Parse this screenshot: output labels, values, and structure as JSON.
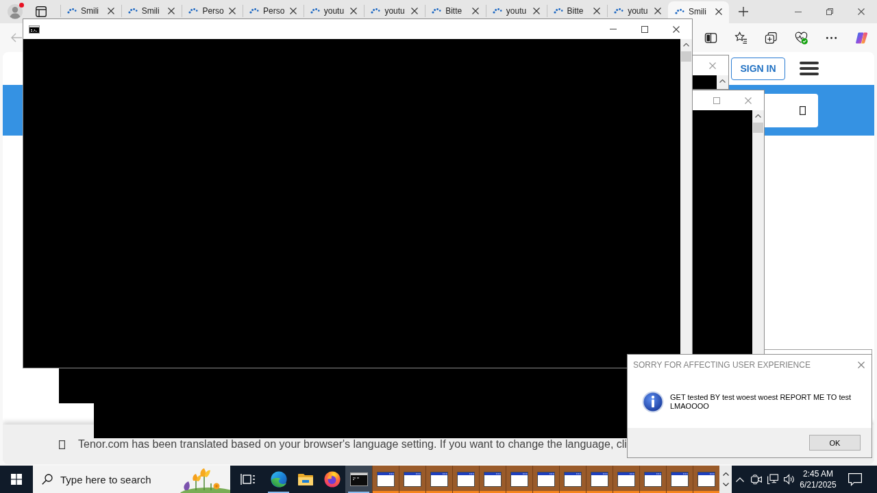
{
  "browser": {
    "profile": {
      "notification": true
    },
    "tabs": [
      {
        "label": "Smili",
        "selected": false
      },
      {
        "label": "Smili",
        "selected": false
      },
      {
        "label": "Perso",
        "selected": false
      },
      {
        "label": "Perso",
        "selected": false
      },
      {
        "label": "youtu",
        "selected": false
      },
      {
        "label": "youtu",
        "selected": false
      },
      {
        "label": "Bitte",
        "selected": false
      },
      {
        "label": "youtu",
        "selected": false
      },
      {
        "label": "Bitte",
        "selected": false
      },
      {
        "label": "youtu",
        "selected": false
      },
      {
        "label": "Smili",
        "selected": true
      }
    ],
    "page": {
      "sign_in": "SIGN IN",
      "translation_notice": "Tenor.com has been translated based on your browser's language setting. If you want to change the language, cli"
    }
  },
  "dialog": {
    "title": "SORRY FOR AFFECTING USER EXPERIENCE",
    "message": "GET tested BY test woest woest REPORT ME TO test LMAOOOO",
    "button": "OK"
  },
  "taskbar": {
    "search": {
      "placeholder": "Type here to search"
    },
    "buttons": [
      {
        "kind": "task-view",
        "selected": false,
        "running": false,
        "flashing": false
      },
      {
        "kind": "edge",
        "selected": false,
        "running": true,
        "flashing": false
      },
      {
        "kind": "explorer",
        "selected": false,
        "running": false,
        "flashing": false
      },
      {
        "kind": "firefox",
        "selected": false,
        "running": false,
        "flashing": false
      },
      {
        "kind": "console",
        "selected": true,
        "running": true,
        "flashing": false
      },
      {
        "kind": "window",
        "selected": false,
        "running": true,
        "flashing": true
      },
      {
        "kind": "window",
        "selected": false,
        "running": true,
        "flashing": true
      },
      {
        "kind": "window",
        "selected": false,
        "running": true,
        "flashing": true
      },
      {
        "kind": "window",
        "selected": false,
        "running": true,
        "flashing": true
      },
      {
        "kind": "window",
        "selected": false,
        "running": true,
        "flashing": true
      },
      {
        "kind": "window",
        "selected": false,
        "running": true,
        "flashing": true
      },
      {
        "kind": "window",
        "selected": false,
        "running": true,
        "flashing": true
      },
      {
        "kind": "window",
        "selected": false,
        "running": true,
        "flashing": true
      },
      {
        "kind": "window",
        "selected": false,
        "running": true,
        "flashing": true
      },
      {
        "kind": "window",
        "selected": false,
        "running": true,
        "flashing": true
      },
      {
        "kind": "window",
        "selected": false,
        "running": true,
        "flashing": true
      },
      {
        "kind": "window",
        "selected": false,
        "running": true,
        "flashing": true
      },
      {
        "kind": "window",
        "selected": false,
        "running": true,
        "flashing": true
      }
    ],
    "clock": {
      "time": "2:45 AM",
      "date": "6/21/2025"
    }
  }
}
